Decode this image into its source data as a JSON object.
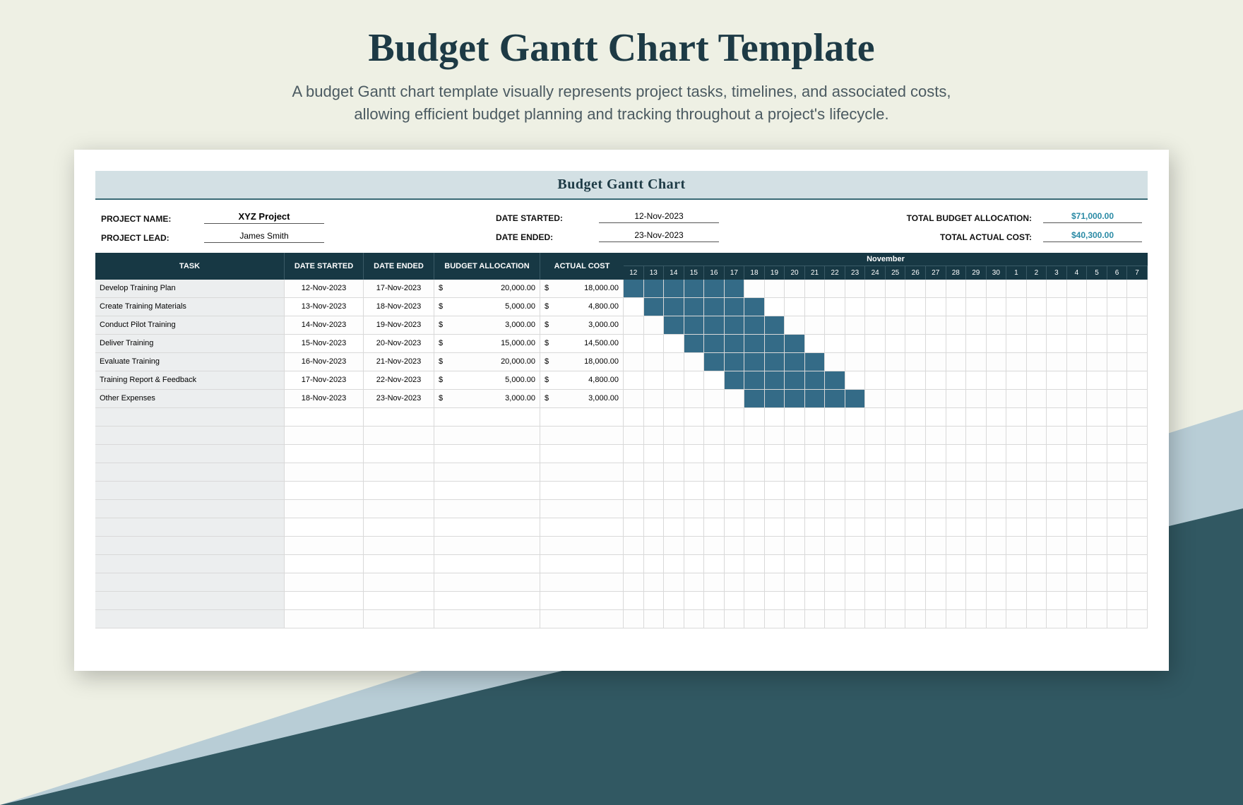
{
  "header": {
    "title": "Budget Gantt Chart Template",
    "subtitle_line1": "A budget Gantt chart template visually represents project tasks, timelines, and associated costs,",
    "subtitle_line2": "allowing efficient budget planning and tracking throughout a project's lifecycle."
  },
  "chart": {
    "title": "Budget Gantt Chart",
    "meta": {
      "project_name_label": "PROJECT NAME:",
      "project_name": "XYZ Project",
      "project_lead_label": "PROJECT LEAD:",
      "project_lead": "James Smith",
      "date_started_label": "DATE STARTED:",
      "date_started": "12-Nov-2023",
      "date_ended_label": "DATE ENDED:",
      "date_ended": "23-Nov-2023",
      "total_budget_label": "TOTAL BUDGET ALLOCATION:",
      "total_budget": "$71,000.00",
      "total_actual_label": "TOTAL ACTUAL COST:",
      "total_actual": "$40,300.00"
    },
    "columns": {
      "task": "TASK",
      "date_started": "DATE STARTED",
      "date_ended": "DATE ENDED",
      "budget_allocation": "BUDGET ALLOCATION",
      "actual_cost": "ACTUAL COST"
    },
    "month_label": "November",
    "days": [
      "12",
      "13",
      "14",
      "15",
      "16",
      "17",
      "18",
      "19",
      "20",
      "21",
      "22",
      "23",
      "24",
      "25",
      "26",
      "27",
      "28",
      "29",
      "30",
      "1",
      "2",
      "3",
      "4",
      "5",
      "6",
      "7"
    ],
    "rows": [
      {
        "task": "Develop Training Plan",
        "ds": "12-Nov-2023",
        "de": "17-Nov-2023",
        "ba": "20,000.00",
        "ac": "18,000.00",
        "start": 0,
        "len": 6
      },
      {
        "task": "Create Training Materials",
        "ds": "13-Nov-2023",
        "de": "18-Nov-2023",
        "ba": "5,000.00",
        "ac": "4,800.00",
        "start": 1,
        "len": 6
      },
      {
        "task": "Conduct Pilot Training",
        "ds": "14-Nov-2023",
        "de": "19-Nov-2023",
        "ba": "3,000.00",
        "ac": "3,000.00",
        "start": 2,
        "len": 6
      },
      {
        "task": "Deliver Training",
        "ds": "15-Nov-2023",
        "de": "20-Nov-2023",
        "ba": "15,000.00",
        "ac": "14,500.00",
        "start": 3,
        "len": 6
      },
      {
        "task": "Evaluate Training",
        "ds": "16-Nov-2023",
        "de": "21-Nov-2023",
        "ba": "20,000.00",
        "ac": "18,000.00",
        "start": 4,
        "len": 6
      },
      {
        "task": "Training Report & Feedback",
        "ds": "17-Nov-2023",
        "de": "22-Nov-2023",
        "ba": "5,000.00",
        "ac": "4,800.00",
        "start": 5,
        "len": 6
      },
      {
        "task": "Other Expenses",
        "ds": "18-Nov-2023",
        "de": "23-Nov-2023",
        "ba": "3,000.00",
        "ac": "3,000.00",
        "start": 6,
        "len": 6
      }
    ],
    "empty_rows": 12,
    "currency": "$"
  },
  "chart_data": {
    "type": "gantt",
    "title": "Budget Gantt Chart",
    "x_unit": "day",
    "x_range": [
      "2023-11-12",
      "2023-12-07"
    ],
    "series": [
      {
        "name": "Develop Training Plan",
        "start": "2023-11-12",
        "end": "2023-11-17",
        "budget": 20000,
        "actual": 18000
      },
      {
        "name": "Create Training Materials",
        "start": "2023-11-13",
        "end": "2023-11-18",
        "budget": 5000,
        "actual": 4800
      },
      {
        "name": "Conduct Pilot Training",
        "start": "2023-11-14",
        "end": "2023-11-19",
        "budget": 3000,
        "actual": 3000
      },
      {
        "name": "Deliver Training",
        "start": "2023-11-15",
        "end": "2023-11-20",
        "budget": 15000,
        "actual": 14500
      },
      {
        "name": "Evaluate Training",
        "start": "2023-11-16",
        "end": "2023-11-21",
        "budget": 20000,
        "actual": 18000
      },
      {
        "name": "Training Report & Feedback",
        "start": "2023-11-17",
        "end": "2023-11-22",
        "budget": 5000,
        "actual": 4800
      },
      {
        "name": "Other Expenses",
        "start": "2023-11-18",
        "end": "2023-11-23",
        "budget": 3000,
        "actual": 3000
      }
    ],
    "totals": {
      "budget": 71000,
      "actual": 40300
    }
  }
}
